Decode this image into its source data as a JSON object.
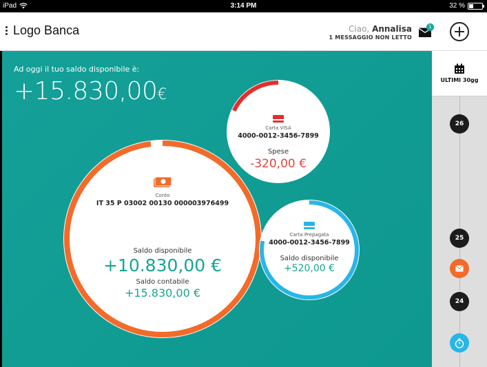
{
  "status_bar": {
    "device": "iPad",
    "time": "3:14 PM",
    "battery": "32 %"
  },
  "header": {
    "logo": "Logo Banca",
    "greeting_prefix": "Ciao,",
    "user_name": "Annalisa",
    "messages_note": "1 MESSAGGIO NON LETTO",
    "mail_badge": "1"
  },
  "balance": {
    "label": "Ad oggi il tuo saldo disponibile è:",
    "value": "+15.830,00",
    "currency": "€"
  },
  "accounts": {
    "conto": {
      "type": "Conto",
      "iban": "IT 35 P 03002 00130 000003976499",
      "disponibile_label": "Saldo disponibile",
      "disponibile_value": "+10.830,00 €",
      "contabile_label": "Saldo contabile",
      "contabile_value": "+15.830,00 €",
      "ring_color": "#f26b2a",
      "ring_fraction": 0.98
    },
    "visa": {
      "type": "Carta VISA",
      "number": "4000-0012-3456-7899",
      "label": "Spese",
      "value": "-320,00 €",
      "ring_color": "#e42e2c",
      "ring_fraction": 0.18
    },
    "prepagata": {
      "type": "Carta Prepagata",
      "number": "4000-0012-3456-7899",
      "label": "Saldo disponibile",
      "value": "+520,00 €",
      "ring_color": "#28b6e8",
      "ring_fraction": 0.78
    }
  },
  "sidebar": {
    "period_label": "ULTIMI 30gg",
    "days": [
      "26",
      "25",
      "24"
    ],
    "event_colors": {
      "mail": "#f26b2a",
      "timer": "#28b6e8"
    }
  }
}
